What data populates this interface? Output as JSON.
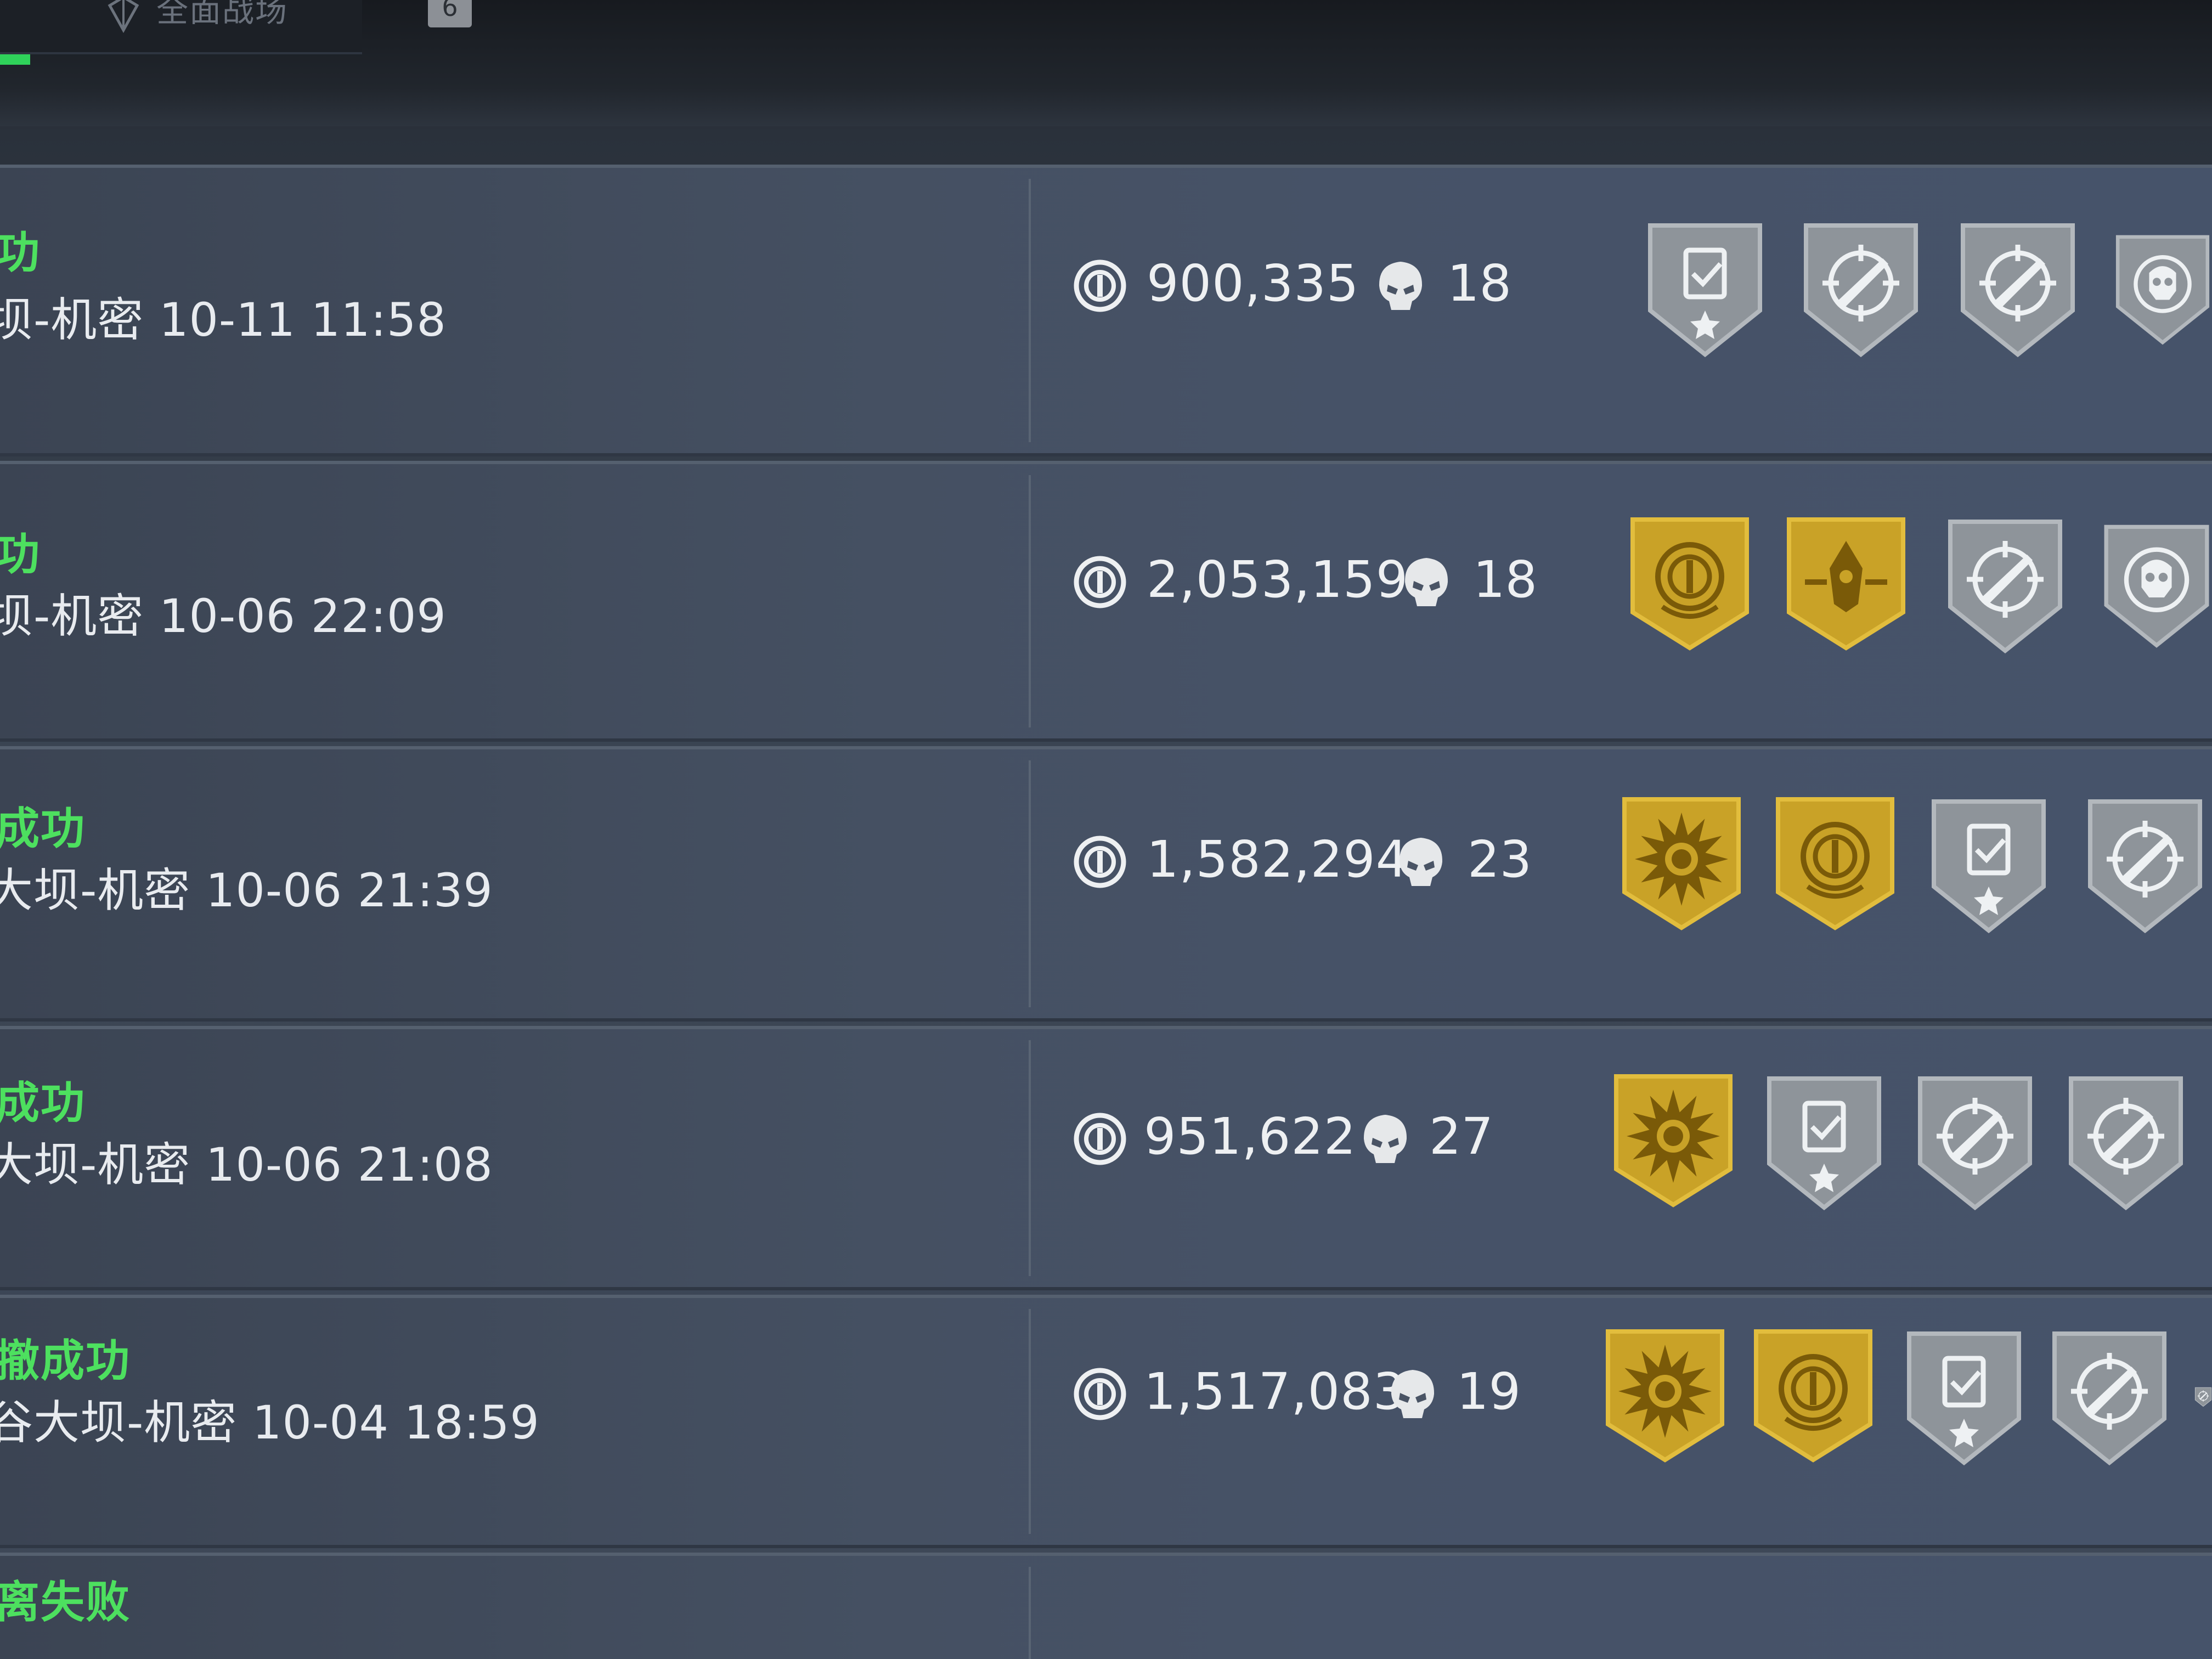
{
  "filter": {
    "label": "全面战场",
    "count": "6"
  },
  "matches": [
    {
      "status": "功",
      "map": "坝-机密 10-11 11:58",
      "value": "900,335",
      "kills": "18",
      "badges": [
        "silver-clipboard",
        "silver-rifle",
        "silver-knife",
        "silver-skull"
      ]
    },
    {
      "status": "功",
      "map": "坝-机密 10-06 22:09",
      "value": "2,053,159",
      "kills": "18",
      "badges": [
        "gold-coin",
        "gold-operator",
        "silver-knife",
        "silver-skull"
      ]
    },
    {
      "status": "成功",
      "map": "大坝-机密 10-06 21:39",
      "value": "1,582,294",
      "kills": "23",
      "badges": [
        "gold-burst",
        "gold-coin",
        "silver-clipboard",
        "silver-rifle"
      ]
    },
    {
      "status": "成功",
      "map": "大坝-机密 10-06 21:08",
      "value": "951,622",
      "kills": "27",
      "badges": [
        "gold-burst",
        "silver-clipboard",
        "silver-rifle",
        "silver-knife"
      ]
    },
    {
      "status": "撤成功",
      "map": "谷大坝-机密 10-04 18:59",
      "value": "1,517,083",
      "kills": "19",
      "badges": [
        "gold-burst",
        "gold-coin",
        "silver-clipboard",
        "silver-rifle",
        "silver-partial"
      ]
    },
    {
      "status": "离失败",
      "map": "",
      "value": "",
      "kills": "",
      "badges": []
    }
  ],
  "colors": {
    "success_green": "#4de05f",
    "badge_gold": "#c9a227",
    "badge_silver": "#8e949a",
    "row_bg": "#455062"
  }
}
